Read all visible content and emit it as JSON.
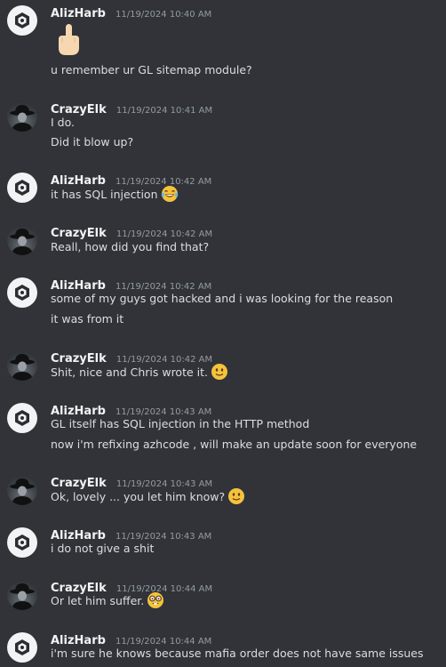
{
  "messages": [
    {
      "author": "AlizHarb",
      "timestamp": "11/19/2024 10:40 AM",
      "avatar": "server-logo-avatar",
      "sticker": "middle-finger-emoji",
      "lines": [
        "u remember ur GL sitemap module?"
      ]
    },
    {
      "author": "CrazyElk",
      "timestamp": "11/19/2024 10:41 AM",
      "avatar": "fedora-man-avatar",
      "lines": [
        "I do.",
        "Did it blow up?"
      ]
    },
    {
      "author": "AlizHarb",
      "timestamp": "11/19/2024 10:42 AM",
      "avatar": "server-logo-avatar",
      "lines": [
        "it has SQL injection"
      ],
      "line_emojis": [
        "tears-of-joy-emoji"
      ]
    },
    {
      "author": "CrazyElk",
      "timestamp": "11/19/2024 10:42 AM",
      "avatar": "fedora-man-avatar",
      "lines": [
        "Reall, how did you find that?"
      ]
    },
    {
      "author": "AlizHarb",
      "timestamp": "11/19/2024 10:42 AM",
      "avatar": "server-logo-avatar",
      "lines": [
        "some of my guys got hacked and i was looking for the reason",
        "it was from it"
      ]
    },
    {
      "author": "CrazyElk",
      "timestamp": "11/19/2024 10:42 AM",
      "avatar": "fedora-man-avatar",
      "lines": [
        "Shit, nice and Chris wrote it."
      ],
      "line_emojis": [
        "slightly-smiling-emoji"
      ]
    },
    {
      "author": "AlizHarb",
      "timestamp": "11/19/2024 10:43 AM",
      "avatar": "server-logo-avatar",
      "lines": [
        "GL itself has SQL injection in the HTTP method",
        "now i'm refixing azhcode , will make an update soon for everyone"
      ]
    },
    {
      "author": "CrazyElk",
      "timestamp": "11/19/2024 10:43 AM",
      "avatar": "fedora-man-avatar",
      "lines": [
        "Ok, lovely ... you let him know?"
      ],
      "line_emojis": [
        "slightly-smiling-emoji"
      ]
    },
    {
      "author": "AlizHarb",
      "timestamp": "11/19/2024 10:43 AM",
      "avatar": "server-logo-avatar",
      "lines": [
        "i do not give a shit"
      ]
    },
    {
      "author": "CrazyElk",
      "timestamp": "11/19/2024 10:44 AM",
      "avatar": "fedora-man-avatar",
      "lines": [
        "Or let him suffer."
      ],
      "line_emojis": [
        "nerd-face-emoji"
      ]
    },
    {
      "author": "AlizHarb",
      "timestamp": "11/19/2024 10:44 AM",
      "avatar": "server-logo-avatar",
      "lines": [
        "i'm sure he knows because mafia order does not have same issues"
      ]
    }
  ],
  "colors": {
    "background": "#313338",
    "username": "#f2f3f5",
    "timestamp": "#949ba4",
    "message_text": "#dbdee1",
    "emoji_yellow": "#f5c33b"
  }
}
